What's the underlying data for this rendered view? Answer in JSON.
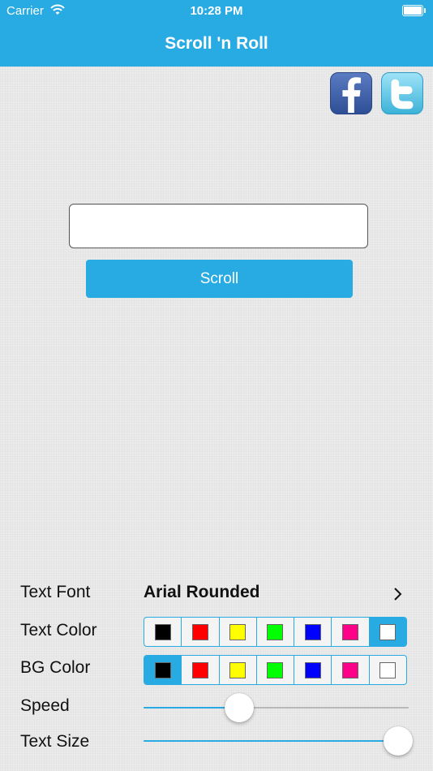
{
  "status_bar": {
    "carrier": "Carrier",
    "time": "10:28 PM"
  },
  "nav": {
    "title": "Scroll 'n Roll"
  },
  "social": {
    "facebook_icon": "facebook-icon",
    "twitter_icon": "twitter-icon"
  },
  "input": {
    "value": "",
    "placeholder": ""
  },
  "scroll_button": {
    "label": "Scroll"
  },
  "settings": {
    "text_font": {
      "label": "Text Font",
      "value": "Arial Rounded"
    },
    "text_color": {
      "label": "Text Color",
      "swatches": [
        "#000000",
        "#ff0000",
        "#ffff00",
        "#00ff00",
        "#0000ff",
        "#ff0088",
        "#ffffff"
      ],
      "selected_index": 6
    },
    "bg_color": {
      "label": "BG Color",
      "swatches": [
        "#000000",
        "#ff0000",
        "#ffff00",
        "#00ff00",
        "#0000ff",
        "#ff0088",
        "#ffffff"
      ],
      "selected_index": 0
    },
    "speed": {
      "label": "Speed",
      "value": 0.36
    },
    "text_size": {
      "label": "Text Size",
      "value": 0.96
    }
  },
  "colors": {
    "accent": "#28aae2"
  }
}
